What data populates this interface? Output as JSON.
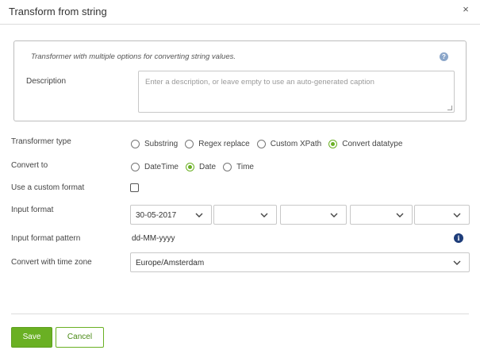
{
  "dialog": {
    "title": "Transform from string",
    "close_glyph": "×"
  },
  "description_section": {
    "intro": "Transformer with multiple options for converting string values.",
    "help_glyph": "?",
    "label": "Description",
    "placeholder": "Enter a description, or leave empty to use an auto-generated caption",
    "value": ""
  },
  "transformer_type": {
    "label": "Transformer type",
    "options": [
      {
        "label": "Substring",
        "checked": false
      },
      {
        "label": "Regex replace",
        "checked": false
      },
      {
        "label": "Custom XPath",
        "checked": false
      },
      {
        "label": "Convert datatype",
        "checked": true
      }
    ]
  },
  "convert_to": {
    "label": "Convert to",
    "options": [
      {
        "label": "DateTime",
        "checked": false
      },
      {
        "label": "Date",
        "checked": true
      },
      {
        "label": "Time",
        "checked": false
      }
    ]
  },
  "custom_format": {
    "label": "Use a custom format",
    "checked": false
  },
  "input_format": {
    "label": "Input format",
    "selects": [
      "30-05-2017",
      "",
      "",
      "",
      ""
    ]
  },
  "input_format_pattern": {
    "label": "Input format pattern",
    "value": "dd-MM-yyyy",
    "info_glyph": "i"
  },
  "time_zone": {
    "label": "Convert with time zone",
    "value": "Europe/Amsterdam"
  },
  "footer": {
    "save_label": "Save",
    "cancel_label": "Cancel"
  },
  "colors": {
    "accent": "#6ab023",
    "info_icon": "#1e3d7a",
    "help_icon": "#8ba6c9"
  }
}
